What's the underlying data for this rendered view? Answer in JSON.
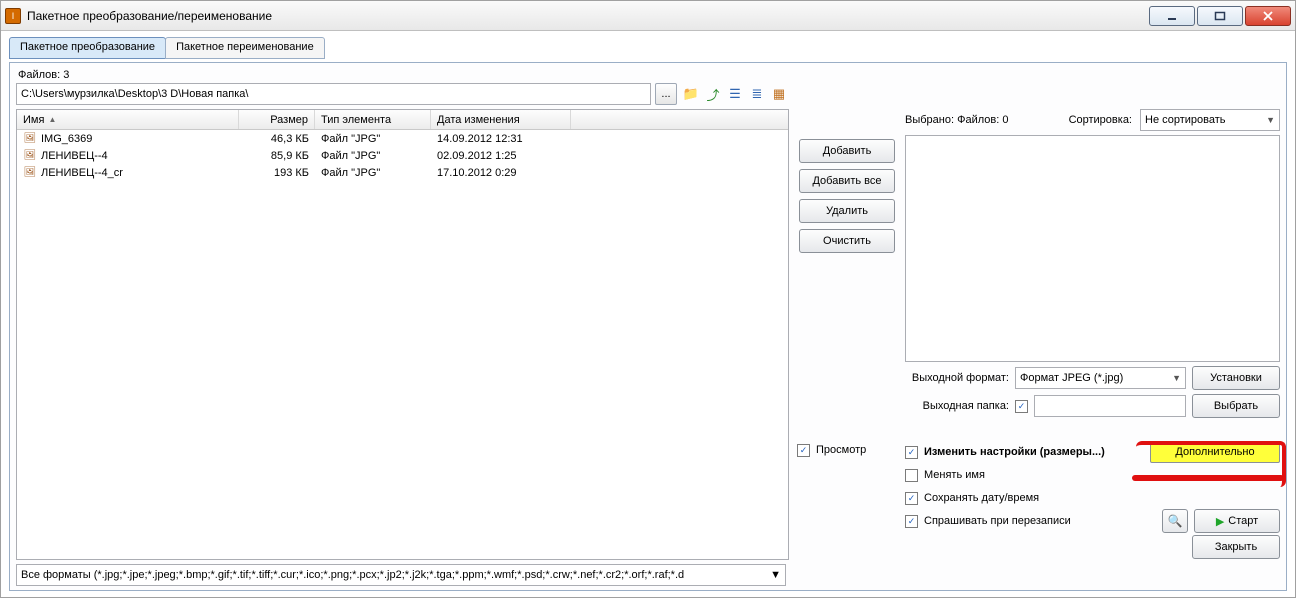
{
  "window": {
    "title": "Пакетное преобразование/переименование"
  },
  "tabs": {
    "convert": "Пакетное преобразование",
    "rename": "Пакетное переименование"
  },
  "files_count_label": "Файлов: 3",
  "path_value": "C:\\Users\\мурзилка\\Desktop\\3 D\\Новая папка\\",
  "path_browse": "...",
  "columns": {
    "name": "Имя",
    "size": "Размер",
    "type": "Тип элемента",
    "date": "Дата изменения"
  },
  "files": [
    {
      "name": "IMG_6369",
      "size": "46,3 КБ",
      "type": "Файл \"JPG\"",
      "date": "14.09.2012 12:31"
    },
    {
      "name": "ЛЕНИВЕЦ--4",
      "size": "85,9 КБ",
      "type": "Файл \"JPG\"",
      "date": "02.09.2012 1:25"
    },
    {
      "name": "ЛЕНИВЕЦ--4_cr",
      "size": "193 КБ",
      "type": "Файл \"JPG\"",
      "date": "17.10.2012 0:29"
    }
  ],
  "filter_text": "Все форматы (*.jpg;*.jpe;*.jpeg;*.bmp;*.gif;*.tif;*.tiff;*.cur;*.ico;*.png;*.pcx;*.jp2;*.j2k;*.tga;*.ppm;*.wmf;*.psd;*.crw;*.nef;*.cr2;*.orf;*.raf;*.d",
  "buttons": {
    "add": "Добавить",
    "add_all": "Добавить все",
    "delete": "Удалить",
    "clear": "Очистить",
    "settings": "Установки",
    "browse": "Выбрать",
    "advanced": "Дополнительно",
    "start": "Старт",
    "close": "Закрыть"
  },
  "right": {
    "selected_label": "Выбрано: Файлов: 0",
    "sort_label": "Сортировка:",
    "sort_value": "Не сортировать",
    "output_format_label": "Выходной формат:",
    "output_format_value": "Формат JPEG (*.jpg)",
    "output_folder_label": "Выходная папка:",
    "output_folder_value": "",
    "preview_label": "Просмотр",
    "change_settings_label": "Изменить настройки (размеры...)",
    "rename_label": "Менять имя",
    "keep_date_label": "Сохранять дату/время",
    "ask_overwrite_label": "Спрашивать при перезаписи"
  }
}
